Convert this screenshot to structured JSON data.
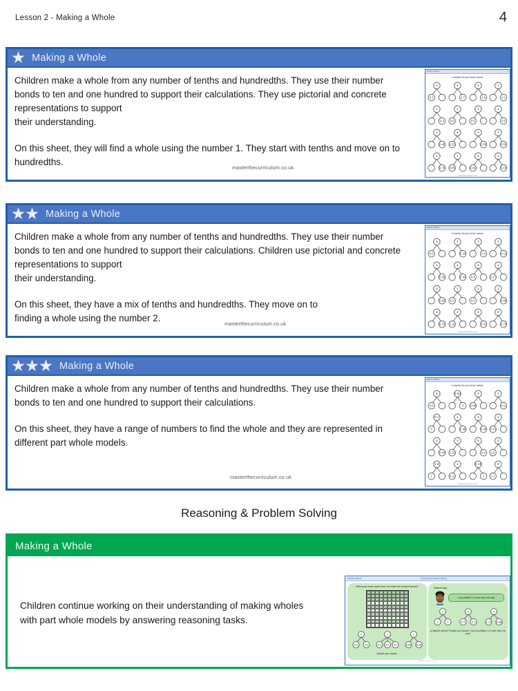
{
  "header": {
    "lesson_title": "Lesson 2 - Making a Whole",
    "page_number": "4"
  },
  "colors": {
    "blue_header": "#4A76C4",
    "blue_border": "#1F5FAD",
    "green_header": "#00A651",
    "green_border": "#00A651",
    "star": "#E8EDF6"
  },
  "watermark": "masterthecurriculum.co.uk",
  "activities": [
    {
      "title": "Making a Whole",
      "stars": 1,
      "description": "Children make a whole from any number of tenths and hundredths. They use their number bonds to ten and one hundred to support their calculations. They use pictorial and concrete representations to support\n their understanding.",
      "description2": "On this sheet, they will find a whole using the number 1. They start with tenths and move on to hundredths.",
      "thumbnail": {
        "doc_title": "Making a Whole",
        "doc_header_right": "Making a Whole",
        "page": "1",
        "instruction": "Complete the part whole models.",
        "footer": "masterthecurriculum.co.uk",
        "models": [
          {
            "whole": "1",
            "left": "0.2",
            "right": ""
          },
          {
            "whole": "1",
            "left": "",
            "right": "0.7"
          },
          {
            "whole": "1",
            "left": "",
            "right": "0.9"
          },
          {
            "whole": "1",
            "left": "",
            "right": "0.1"
          },
          {
            "whole": "1",
            "left": "",
            "right": "0.3"
          },
          {
            "whole": "1",
            "left": "0.6",
            "right": ""
          },
          {
            "whole": "1",
            "left": "0.5",
            "right": ""
          },
          {
            "whole": "1",
            "left": "",
            "right": "0.5"
          },
          {
            "whole": "1",
            "left": "",
            "right": "0.45"
          },
          {
            "whole": "1",
            "left": "0.25",
            "right": ""
          },
          {
            "whole": "1",
            "left": "",
            "right": "0.35"
          },
          {
            "whole": "1",
            "left": "",
            "right": "0.55"
          },
          {
            "whole": "1",
            "left": "",
            "right": "0.75"
          },
          {
            "whole": "1",
            "left": "0.85",
            "right": ""
          },
          {
            "whole": "1",
            "left": "0.65",
            "right": ""
          },
          {
            "whole": "1",
            "left": "",
            "right": "0.15"
          }
        ]
      }
    },
    {
      "title": "Making a Whole",
      "stars": 2,
      "description": "Children make a whole from any number of tenths and hundredths. They use their number bonds to ten and one hundred to support their calculations. Children use pictorial and concrete representations to support\ntheir understanding.",
      "description2": "On this sheet, they have a mix of tenths and hundredths. They move on to\n finding a whole using the number 2.",
      "thumbnail": {
        "doc_title": "Making a Whole",
        "doc_header_right": "Making a Whole",
        "page": "2",
        "instruction": "Complete the part whole models.",
        "footer": "masterthecurriculum.co.uk",
        "models": [
          {
            "whole": "1",
            "left": "0.3",
            "right": ""
          },
          {
            "whole": "1",
            "left": "",
            "right": "0.24"
          },
          {
            "whole": "1",
            "left": "",
            "right": "0.4"
          },
          {
            "whole": "1",
            "left": "",
            "right": "0.12"
          },
          {
            "whole": "1",
            "left": "",
            "right": "0.65"
          },
          {
            "whole": "1",
            "left": "",
            "right": "0.43"
          },
          {
            "whole": "1",
            "left": "0.4",
            "right": ""
          },
          {
            "whole": "1",
            "left": "0.17",
            "right": ""
          },
          {
            "whole": "1",
            "left": "",
            "right": "0.82"
          },
          {
            "whole": "1",
            "left": "0.5",
            "right": ""
          },
          {
            "whole": "1",
            "left": "0.1",
            "right": ""
          },
          {
            "whole": "1",
            "left": "",
            "right": "0.58"
          },
          {
            "whole": "2",
            "left": "",
            "right": "0.75"
          },
          {
            "whole": "2",
            "left": "1.11",
            "right": ""
          },
          {
            "whole": "2",
            "left": "",
            "right": "0.41"
          },
          {
            "whole": "2",
            "left": "",
            "right": "0.78"
          }
        ]
      }
    },
    {
      "title": "Making a Whole",
      "stars": 3,
      "description": "Children make a whole from any number of tenths and hundredths. They use their number bonds to ten and one hundred to support their calculations.",
      "description2": "On this sheet, they have a range of numbers to find the whole and they are represented in different part whole models.",
      "thumbnail": {
        "doc_title": "Making a Whole",
        "doc_header_right": "Making a Whole",
        "page": "3",
        "instruction": "Complete the part whole models.",
        "footer": "masterthecurriculum.co.uk",
        "models": [
          {
            "whole": "1",
            "left": "0.6",
            "right": ""
          },
          {
            "whole": "0.64",
            "left": "",
            "right": "3"
          },
          {
            "whole": "2",
            "left": "0.99",
            "right": ""
          },
          {
            "whole": "1",
            "left": "",
            "right": "0.11"
          },
          {
            "whole": "0.7",
            "left": "5",
            "right": ""
          },
          {
            "whole": "4",
            "left": "",
            "right": "0.48"
          },
          {
            "whole": "3",
            "left": "",
            "right": "0.46"
          },
          {
            "whole": "1",
            "left": "0.74",
            "right": ""
          },
          {
            "whole": "1",
            "left": "",
            "right": "0.44"
          },
          {
            "whole": "3",
            "left": "1.32",
            "right": ""
          },
          {
            "whole": "5",
            "left": "",
            "right": "0.4"
          },
          {
            "whole": "6",
            "left": "1.5",
            "right": ""
          },
          {
            "whole": "1.8",
            "left": "2",
            "right": ""
          },
          {
            "whole": "1",
            "left": "0.11",
            "right": ""
          },
          {
            "whole": "0.19",
            "left": "",
            "right": "1"
          },
          {
            "whole": "2",
            "left": "1.1",
            "right": ""
          }
        ]
      }
    }
  ],
  "reasoning": {
    "section_title": "Reasoning & Problem Solving",
    "title": "Making a Whole",
    "description": "Children continue working on their understanding of making wholes\n with part whole models by answering reasoning tasks.",
    "thumbnail": {
      "doc_title": "Making a Whole",
      "doc_header_right": "Reasoning & Problem Solving",
      "page": "4",
      "footer": "masterthecurriculum.co.uk",
      "left_panel": {
        "question": "Which part-whole model does not match the hundred square?",
        "models": [
          {
            "whole": "1",
            "parts": [
              "0.6",
              "0.4"
            ]
          },
          {
            "whole": "1",
            "parts": [
              "0.2",
              "0.1",
              "0.2"
            ]
          },
          {
            "whole": "1",
            "parts": [
              "0.06",
              "0.04"
            ]
          }
        ],
        "prompt": "Explain your answer."
      },
      "right_panel": {
        "speaker_intro": "Malachi says,",
        "speech": "I can partition 3 in more than one way.",
        "models": [
          {
            "whole": "3",
            "parts": [
              "2",
              "1"
            ]
          },
          {
            "whole": "3",
            "parts": [
              "0.9",
              "2.1"
            ]
          },
          {
            "whole": "3",
            "parts": [
              "2.12",
              "0.88"
            ]
          }
        ],
        "prompts": "Is Malachi correct?\nExplain your answer.\nCan you partition 3 in more than one way?"
      }
    }
  }
}
